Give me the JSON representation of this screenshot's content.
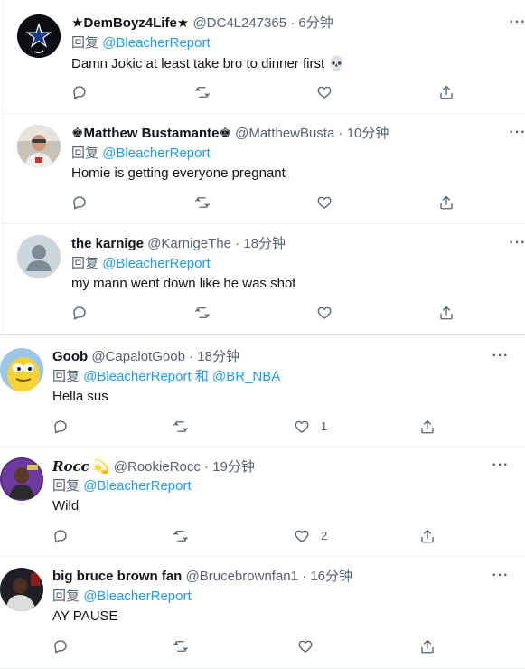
{
  "tweets": [
    {
      "name": "★DemBoyz4Life★",
      "handle": "@DC4L247365",
      "time": "· 6分钟",
      "reply_prefix": "回复",
      "reply_to": "@BleacherReport",
      "text": "Damn Jokic at least take bro to dinner first",
      "emoji": "💀",
      "likes": ""
    },
    {
      "name": "♚Matthew Bustamante♚",
      "handle": "@MatthewBusta",
      "time": "· 10分钟",
      "reply_prefix": "回复",
      "reply_to": "@BleacherReport",
      "text": "Homie is getting everyone pregnant",
      "likes": ""
    },
    {
      "name": "the karnige",
      "handle": "@KarnigeThe",
      "time": "· 18分钟",
      "reply_prefix": "回复",
      "reply_to": "@BleacherReport",
      "text": "my mann went down like he was shot",
      "likes": ""
    },
    {
      "name": "Goob",
      "handle": "@CapalotGoob",
      "time": "· 18分钟",
      "reply_prefix": "回复",
      "reply_to": "@BleacherReport",
      "reply_and": "和",
      "reply_to2": "@BR_NBA",
      "text": "Hella sus",
      "likes": "1"
    },
    {
      "name": "Rocc",
      "name_emoji": "💫",
      "handle": "@RookieRocc",
      "time": "· 19分钟",
      "reply_prefix": "回复",
      "reply_to": "@BleacherReport",
      "text": "Wild",
      "likes": "2"
    },
    {
      "name": "big bruce brown fan",
      "handle": "@Brucebrownfan1",
      "time": "· 16分钟",
      "reply_prefix": "回复",
      "reply_to": "@BleacherReport",
      "text": "AY PAUSE",
      "likes": ""
    }
  ],
  "icons": {
    "more": "more-icon",
    "reply": "reply-icon",
    "retweet": "retweet-icon",
    "like": "heart-icon",
    "share": "share-icon"
  },
  "colors": {
    "link": "#1d9bf0",
    "muted": "#536471",
    "text": "#0f1419",
    "divider": "#eff3f4"
  }
}
